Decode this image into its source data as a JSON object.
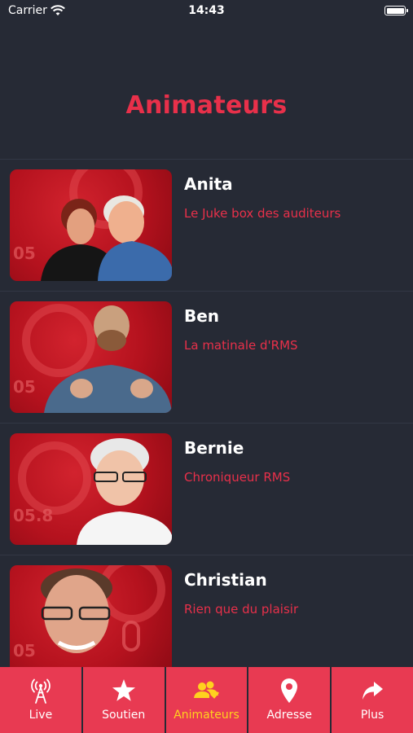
{
  "status": {
    "carrier": "Carrier",
    "time": "14:43"
  },
  "page": {
    "title": "Animateurs"
  },
  "hosts": [
    {
      "name": "Anita",
      "show": "Le Juke box des auditeurs"
    },
    {
      "name": "Ben",
      "show": "La matinale d'RMS"
    },
    {
      "name": "Bernie",
      "show": "Chroniqueur RMS"
    },
    {
      "name": "Christian",
      "show": "Rien que du plaisir"
    }
  ],
  "tabs": [
    {
      "label": "Live",
      "icon": "antenna-icon"
    },
    {
      "label": "Soutien",
      "icon": "star-icon"
    },
    {
      "label": "Animateurs",
      "icon": "users-icon",
      "active": true
    },
    {
      "label": "Adresse",
      "icon": "map-pin-icon"
    },
    {
      "label": "Plus",
      "icon": "share-arrow-icon"
    }
  ],
  "colors": {
    "background": "#262a35",
    "accent": "#e8304a",
    "tab_bg": "#e83a52",
    "active_tab_text": "#ffd21e"
  }
}
